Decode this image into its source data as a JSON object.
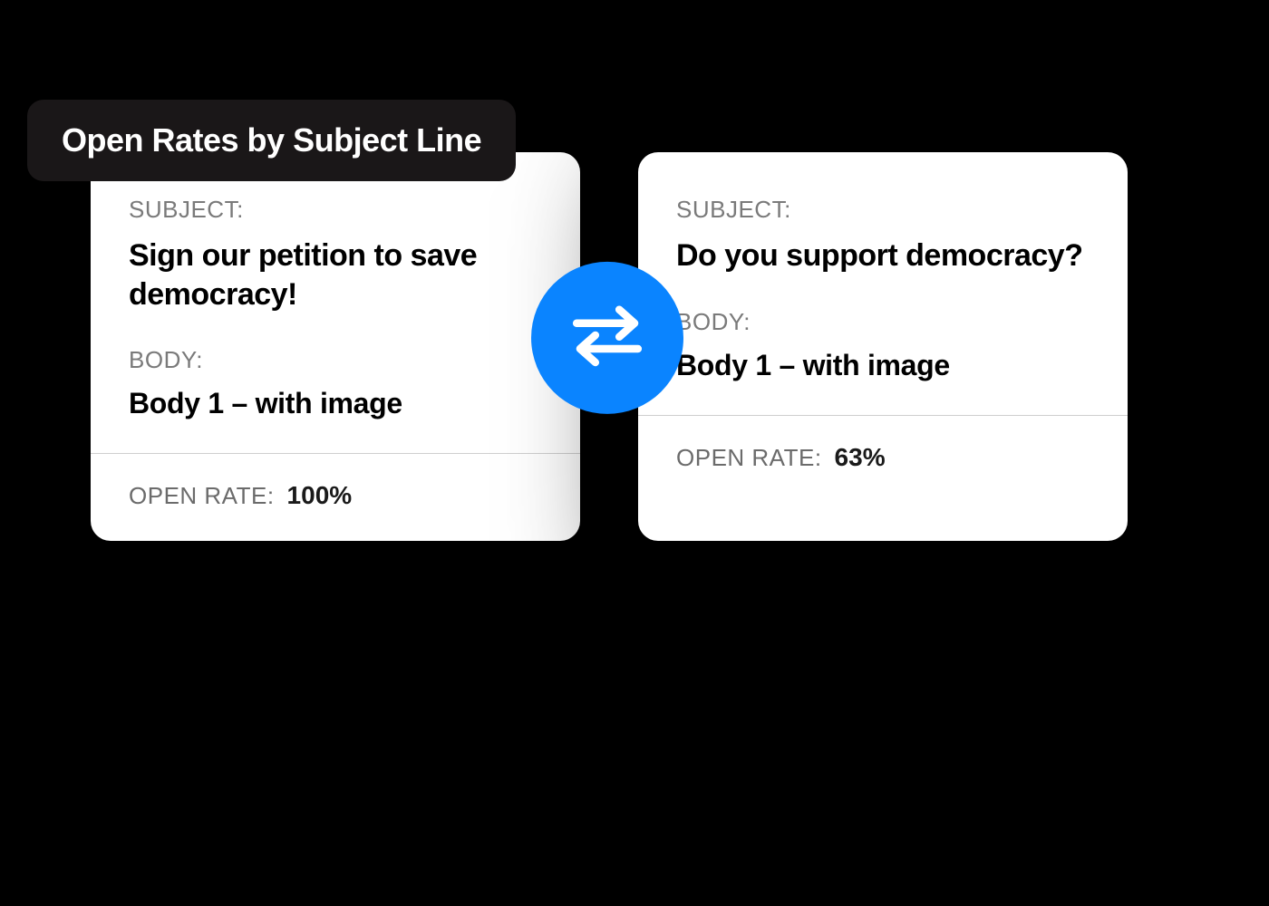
{
  "header": {
    "title": "Open Rates by Subject Line"
  },
  "labels": {
    "subject": "SUBJECT:",
    "body": "BODY:",
    "open_rate": "OPEN RATE:"
  },
  "cards": [
    {
      "subject": "Sign our petition to save democracy!",
      "body": "Body 1 – with image",
      "open_rate": "100%"
    },
    {
      "subject": "Do you support democracy?",
      "body": "Body 1 – with image",
      "open_rate": "63%"
    }
  ],
  "icons": {
    "swap": "swap-arrows"
  },
  "colors": {
    "accent": "#0a84ff",
    "pill_bg": "#1a1718",
    "card_bg": "#ffffff",
    "label_gray": "#7a7a7a"
  }
}
